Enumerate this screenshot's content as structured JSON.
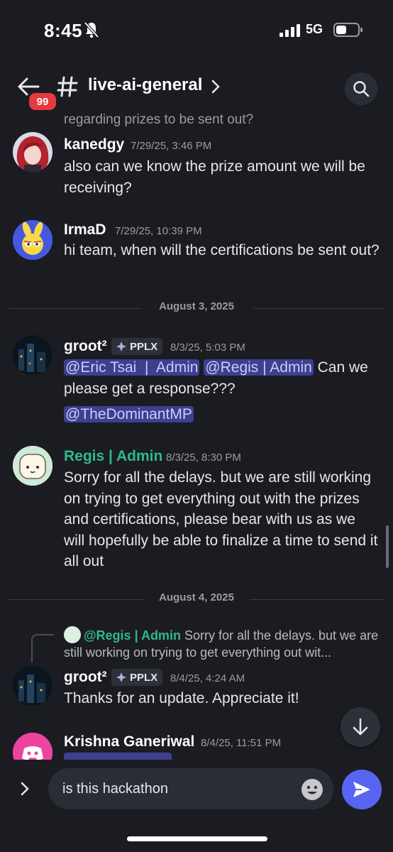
{
  "status": {
    "time": "8:45",
    "network": "5G"
  },
  "header": {
    "badge": "99",
    "channel": "live-ai-general"
  },
  "colors": {
    "accent": "#5865f2",
    "mention_bg": "#3d3f8f",
    "admin_green": "#2fb98a",
    "badge_red": "#e5383f"
  },
  "prev_message_tail": "regarding prizes to be sent out?",
  "messages": [
    {
      "author": "kanedgy",
      "time": "7/29/25, 3:46 PM",
      "text": "also can we know the prize amount we will be receiving?"
    },
    {
      "author": "IrmaD",
      "time": "7/29/25, 10:39 PM",
      "text": "hi team, when will the certifications be sent out?"
    },
    {
      "author": "groot²",
      "tag": "PPLX",
      "time": "8/3/25, 5:03 PM",
      "mention1": "@Eric Tsai  |  Admin",
      "mention2": "@Regis | Admin",
      "text": "Can we please get a response???",
      "mention3": "@TheDominantMP"
    },
    {
      "author": "Regis | Admin",
      "time": "8/3/25, 8:30 PM",
      "text": "Sorry for all the delays. but we are still working on trying to get everything out with the prizes and certifications, please bear with us as we will hopefully be able to finalize a time to send it all out"
    },
    {
      "author": "groot²",
      "tag": "PPLX",
      "time": "8/4/25, 4:24 AM",
      "text": "Thanks for an update. Appreciate it!",
      "reply_name": "@Regis | Admin",
      "reply_text": "Sorry for all the delays. but we are still working on trying to get everything out wit..."
    },
    {
      "author": "Krishna Ganeriwal",
      "time": "8/4/25, 11:51 PM"
    }
  ],
  "dividers": {
    "d1": "August 3, 2025",
    "d2": "August 4, 2025"
  },
  "composer": {
    "value": "is this hackathon"
  }
}
